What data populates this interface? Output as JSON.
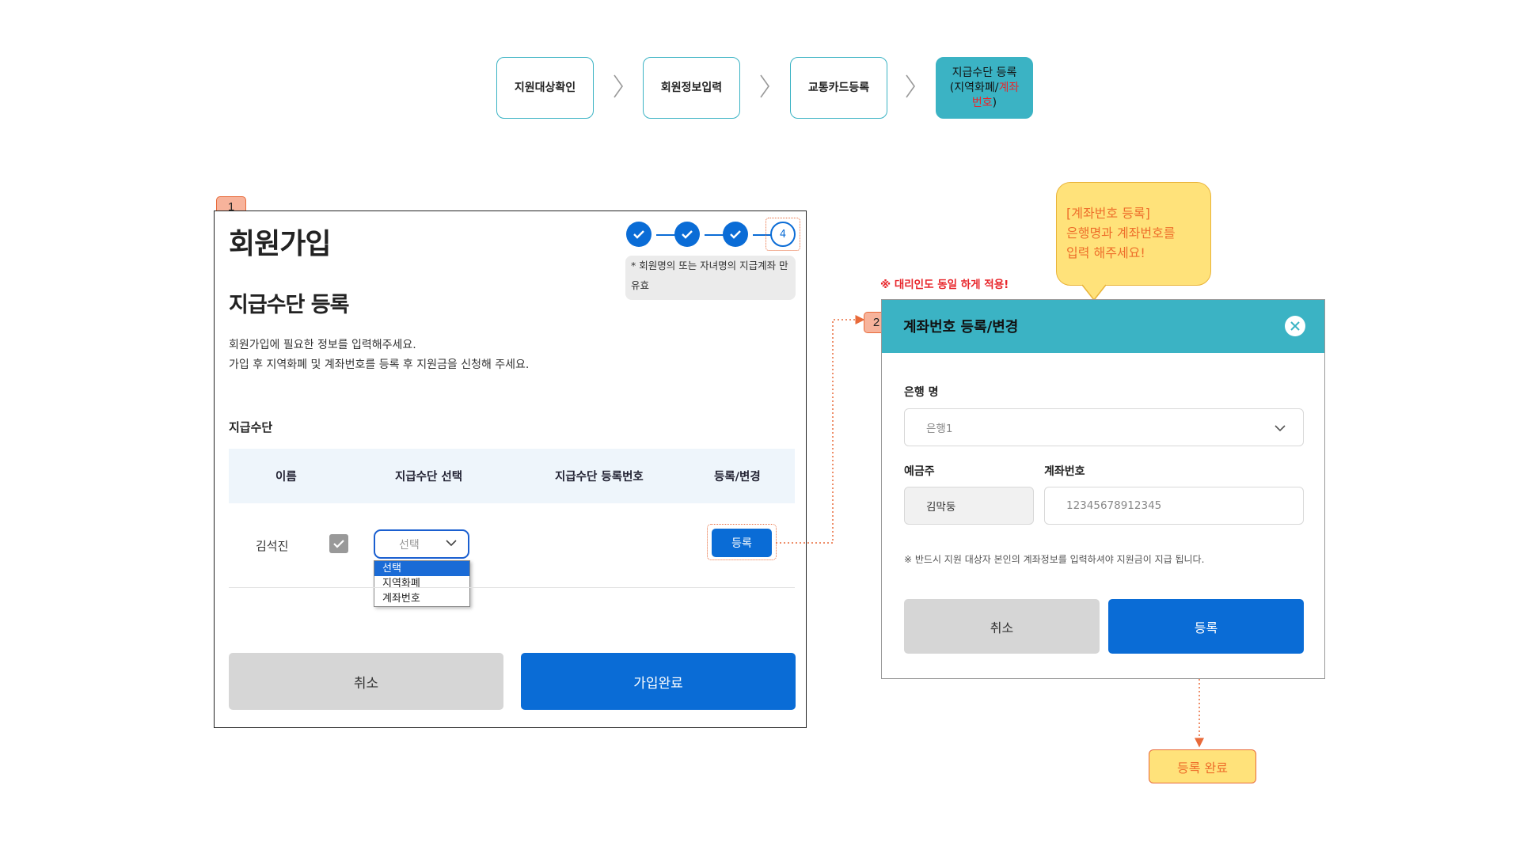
{
  "flow": {
    "steps": [
      {
        "label": "지원대상확인"
      },
      {
        "label": "회원정보입력"
      },
      {
        "label": "교통카드등록"
      }
    ],
    "active_step": {
      "line1": "지급수단 등록",
      "line2_prefix": "(지역화폐/",
      "line2_red": "계좌",
      "line3_red": "번호",
      "line3_suffix": ")"
    }
  },
  "badges": {
    "one": "1",
    "two": "2"
  },
  "signup": {
    "title": "회원가입",
    "section_title": "지급수단 등록",
    "desc_line1": "회원가입에 필요한 정보를 입력해주세요.",
    "desc_line2": "가입 후 지역화폐 및 계좌번호를 등록 후 지원금을 신청해 주세요.",
    "progress": {
      "current": "4",
      "completed_steps": 3
    },
    "note": "* 회원명의 또는 자녀명의 지급계좌 만 유효",
    "field_label": "지급수단",
    "table": {
      "headers": [
        "이름",
        "지급수단 선택",
        "지급수단 등록번호",
        "등록/변경"
      ],
      "row": {
        "name": "김석진",
        "checked": true,
        "select_value": "선택",
        "register_label": "등록"
      }
    },
    "dropdown_options": [
      "선택",
      "지역화폐",
      "계좌번호"
    ],
    "cancel_label": "취소",
    "submit_label": "가입완료"
  },
  "modal": {
    "title": "계좌번호 등록/변경",
    "bank_label": "은행 명",
    "bank_value": "은행1",
    "holder_label": "예금주",
    "holder_value": "김막둥",
    "account_label": "계좌번호",
    "account_placeholder": "12345678912345",
    "note": "※ 반드시 지원 대상자 본인의 계좌정보를 입력하셔야 지원금이 지급 됩니다.",
    "cancel_label": "취소",
    "register_label": "등록"
  },
  "callout": {
    "line1": "[계좌번호 등록]",
    "line2": "은행명과 계좌번호를",
    "line3": "입력 해주세요!"
  },
  "agent_note": "※ 대리인도 동일 하게 적용!",
  "done_label": "등록 완료",
  "colors": {
    "teal": "#3bb3c4",
    "blue": "#0a6cd6",
    "orange": "#e86a3a",
    "yellow": "#ffe27a",
    "red": "#e8262b"
  }
}
